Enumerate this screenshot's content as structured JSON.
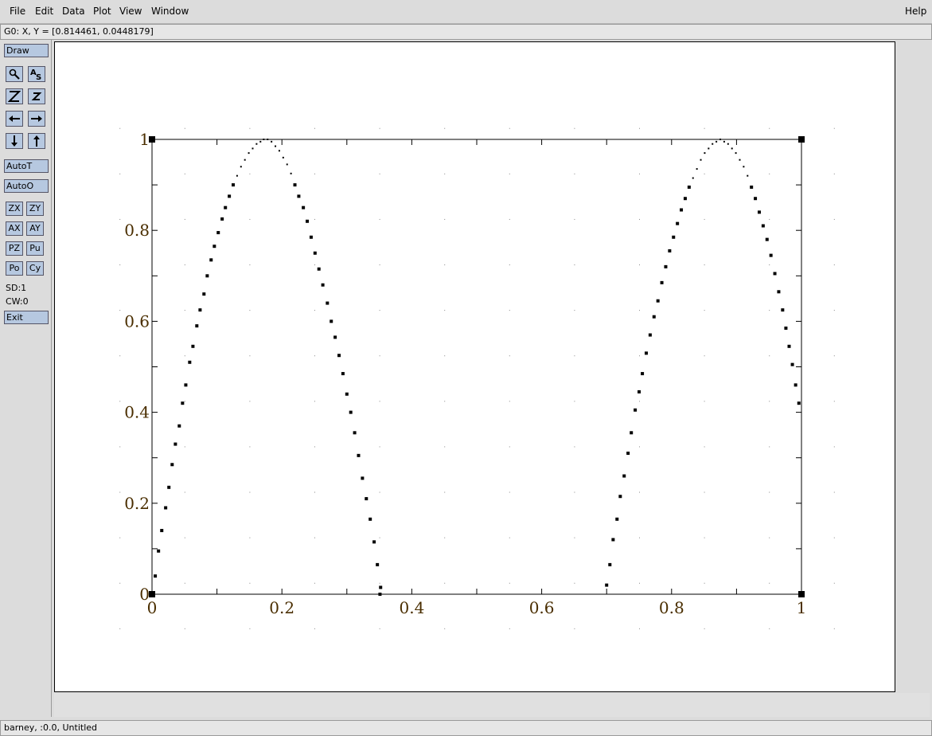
{
  "menubar": {
    "items": [
      "File",
      "Edit",
      "Data",
      "Plot",
      "View",
      "Window"
    ],
    "help": "Help"
  },
  "coord_readout": "G0: X, Y = [0.814461, 0.0448179]",
  "toolbox": {
    "draw": "Draw",
    "autoT": "AutoT",
    "autoO": "AutoO",
    "zx": "ZX",
    "zy": "ZY",
    "ax": "AX",
    "ay": "AY",
    "pz": "PZ",
    "pu": "Pu",
    "po": "Po",
    "cy": "Cy",
    "sd": "SD:1",
    "cw": "CW:0",
    "exit": "Exit",
    "icons": [
      "magnify-icon",
      "autoscale-text-icon",
      "zoom-in-icon",
      "zoom-out-icon",
      "pan-left-icon",
      "pan-right-icon",
      "pan-down-icon",
      "pan-up-icon"
    ]
  },
  "status": "barney, :0.0, Untitled",
  "colors": {
    "button": "#b6c8e0",
    "tick_label": "#4a2e00",
    "chrome": "#dcdcdc"
  },
  "chart_data": {
    "type": "scatter",
    "title": "",
    "xlabel": "",
    "ylabel": "",
    "xlim": [
      0,
      1
    ],
    "ylim": [
      0,
      1
    ],
    "x_ticks": [
      "0",
      "0.2",
      "0.4",
      "0.6",
      "0.8",
      "1"
    ],
    "y_ticks": [
      "0",
      "0.2",
      "0.4",
      "0.6",
      "0.8",
      "1"
    ],
    "grid": "dotted",
    "series": [
      {
        "marker": "square",
        "color": "#000000",
        "points": [
          [
            0.005,
            0.04
          ],
          [
            0.01,
            0.095
          ],
          [
            0.015,
            0.14
          ],
          [
            0.021,
            0.19
          ],
          [
            0.026,
            0.235
          ],
          [
            0.031,
            0.285
          ],
          [
            0.036,
            0.33
          ],
          [
            0.042,
            0.37
          ],
          [
            0.047,
            0.42
          ],
          [
            0.052,
            0.46
          ],
          [
            0.058,
            0.51
          ],
          [
            0.063,
            0.545
          ],
          [
            0.069,
            0.59
          ],
          [
            0.074,
            0.625
          ],
          [
            0.08,
            0.66
          ],
          [
            0.085,
            0.7
          ],
          [
            0.091,
            0.735
          ],
          [
            0.096,
            0.765
          ],
          [
            0.102,
            0.795
          ],
          [
            0.108,
            0.825
          ],
          [
            0.113,
            0.85
          ],
          [
            0.119,
            0.875
          ],
          [
            0.125,
            0.9
          ],
          [
            0.131,
            0.92
          ],
          [
            0.137,
            0.94
          ],
          [
            0.143,
            0.955
          ],
          [
            0.149,
            0.97
          ],
          [
            0.155,
            0.98
          ],
          [
            0.161,
            0.99
          ],
          [
            0.167,
            0.995
          ],
          [
            0.172,
            1.0
          ],
          [
            0.178,
            1.0
          ],
          [
            0.184,
            0.995
          ],
          [
            0.19,
            0.985
          ],
          [
            0.196,
            0.975
          ],
          [
            0.202,
            0.96
          ],
          [
            0.208,
            0.945
          ],
          [
            0.214,
            0.925
          ],
          [
            0.22,
            0.9
          ],
          [
            0.226,
            0.875
          ],
          [
            0.233,
            0.85
          ],
          [
            0.239,
            0.82
          ],
          [
            0.245,
            0.785
          ],
          [
            0.251,
            0.75
          ],
          [
            0.257,
            0.715
          ],
          [
            0.263,
            0.68
          ],
          [
            0.27,
            0.64
          ],
          [
            0.276,
            0.6
          ],
          [
            0.282,
            0.565
          ],
          [
            0.288,
            0.525
          ],
          [
            0.294,
            0.485
          ],
          [
            0.3,
            0.44
          ],
          [
            0.306,
            0.4
          ],
          [
            0.312,
            0.355
          ],
          [
            0.318,
            0.305
          ],
          [
            0.324,
            0.255
          ],
          [
            0.33,
            0.21
          ],
          [
            0.336,
            0.165
          ],
          [
            0.342,
            0.115
          ],
          [
            0.347,
            0.065
          ],
          [
            0.352,
            0.015
          ],
          [
            0.351,
            0.0
          ],
          [
            0.7,
            0.02
          ],
          [
            0.705,
            0.065
          ],
          [
            0.71,
            0.12
          ],
          [
            0.716,
            0.165
          ],
          [
            0.721,
            0.215
          ],
          [
            0.727,
            0.26
          ],
          [
            0.733,
            0.31
          ],
          [
            0.738,
            0.355
          ],
          [
            0.744,
            0.405
          ],
          [
            0.75,
            0.445
          ],
          [
            0.755,
            0.485
          ],
          [
            0.761,
            0.53
          ],
          [
            0.767,
            0.57
          ],
          [
            0.773,
            0.61
          ],
          [
            0.779,
            0.645
          ],
          [
            0.785,
            0.685
          ],
          [
            0.791,
            0.72
          ],
          [
            0.797,
            0.755
          ],
          [
            0.803,
            0.785
          ],
          [
            0.809,
            0.815
          ],
          [
            0.815,
            0.845
          ],
          [
            0.821,
            0.87
          ],
          [
            0.827,
            0.895
          ],
          [
            0.833,
            0.915
          ],
          [
            0.839,
            0.935
          ],
          [
            0.845,
            0.955
          ],
          [
            0.851,
            0.97
          ],
          [
            0.857,
            0.98
          ],
          [
            0.863,
            0.99
          ],
          [
            0.869,
            0.995
          ],
          [
            0.875,
            1.0
          ],
          [
            0.881,
            0.995
          ],
          [
            0.887,
            0.99
          ],
          [
            0.893,
            0.98
          ],
          [
            0.899,
            0.97
          ],
          [
            0.905,
            0.955
          ],
          [
            0.911,
            0.94
          ],
          [
            0.917,
            0.92
          ],
          [
            0.923,
            0.895
          ],
          [
            0.929,
            0.87
          ],
          [
            0.935,
            0.84
          ],
          [
            0.941,
            0.81
          ],
          [
            0.947,
            0.78
          ],
          [
            0.953,
            0.745
          ],
          [
            0.959,
            0.705
          ],
          [
            0.965,
            0.665
          ],
          [
            0.971,
            0.625
          ],
          [
            0.976,
            0.585
          ],
          [
            0.981,
            0.545
          ],
          [
            0.986,
            0.505
          ],
          [
            0.991,
            0.46
          ],
          [
            0.996,
            0.42
          ]
        ]
      }
    ]
  }
}
